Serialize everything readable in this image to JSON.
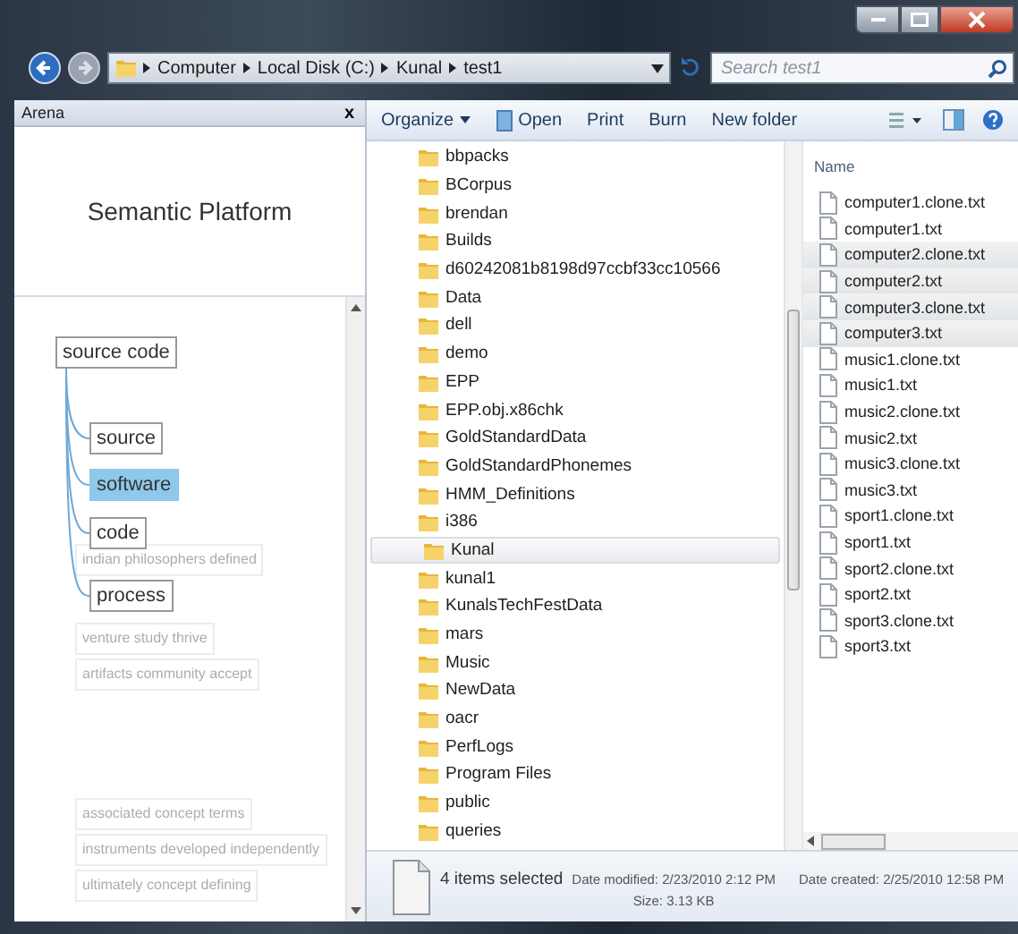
{
  "address_bar": {
    "crumbs": [
      "Computer",
      "Local Disk (C:)",
      "Kunal",
      "test1"
    ]
  },
  "search": {
    "placeholder": "Search test1"
  },
  "arena": {
    "title": "Arena",
    "close": "x",
    "heading": "Semantic Platform",
    "background_terms": [
      {
        "label": "indian philosophers defined"
      },
      {
        "label": "venture study thrive"
      },
      {
        "label": "artifacts community accept"
      },
      {
        "label": "associated concept terms"
      },
      {
        "label": "instruments developed independently"
      },
      {
        "label": "ultimately concept defining"
      }
    ],
    "nodes": [
      {
        "label": "source code",
        "selected": false
      },
      {
        "label": "source",
        "selected": false
      },
      {
        "label": "software",
        "selected": true
      },
      {
        "label": "code",
        "selected": false
      },
      {
        "label": "process",
        "selected": false
      }
    ]
  },
  "toolbar": {
    "items": [
      {
        "label": "Organize",
        "kind": "menu"
      },
      {
        "label": "Open",
        "kind": "icon"
      },
      {
        "label": "Print",
        "kind": "plain"
      },
      {
        "label": "Burn",
        "kind": "plain"
      },
      {
        "label": "New folder",
        "kind": "plain"
      }
    ]
  },
  "folders": [
    {
      "name": "bbpacks",
      "selected": false
    },
    {
      "name": "BCorpus",
      "selected": false
    },
    {
      "name": "brendan",
      "selected": false
    },
    {
      "name": "Builds",
      "selected": false
    },
    {
      "name": "d60242081b8198d97ccbf33cc10566",
      "selected": false
    },
    {
      "name": "Data",
      "selected": false
    },
    {
      "name": "dell",
      "selected": false
    },
    {
      "name": "demo",
      "selected": false
    },
    {
      "name": "EPP",
      "selected": false
    },
    {
      "name": "EPP.obj.x86chk",
      "selected": false
    },
    {
      "name": "GoldStandardData",
      "selected": false
    },
    {
      "name": "GoldStandardPhonemes",
      "selected": false
    },
    {
      "name": "HMM_Definitions",
      "selected": false
    },
    {
      "name": "i386",
      "selected": false
    },
    {
      "name": "Kunal",
      "selected": true
    },
    {
      "name": "kunal1",
      "selected": false
    },
    {
      "name": "KunalsTechFestData",
      "selected": false
    },
    {
      "name": "mars",
      "selected": false
    },
    {
      "name": "Music",
      "selected": false
    },
    {
      "name": "NewData",
      "selected": false
    },
    {
      "name": "oacr",
      "selected": false
    },
    {
      "name": "PerfLogs",
      "selected": false
    },
    {
      "name": "Program Files",
      "selected": false
    },
    {
      "name": "public",
      "selected": false
    },
    {
      "name": "queries",
      "selected": false
    }
  ],
  "files": {
    "column": "Name",
    "items": [
      {
        "name": "computer1.clone.txt",
        "selected": false
      },
      {
        "name": "computer1.txt",
        "selected": false
      },
      {
        "name": "computer2.clone.txt",
        "selected": true
      },
      {
        "name": "computer2.txt",
        "selected": true
      },
      {
        "name": "computer3.clone.txt",
        "selected": true
      },
      {
        "name": "computer3.txt",
        "selected": true
      },
      {
        "name": "music1.clone.txt",
        "selected": false
      },
      {
        "name": "music1.txt",
        "selected": false
      },
      {
        "name": "music2.clone.txt",
        "selected": false
      },
      {
        "name": "music2.txt",
        "selected": false
      },
      {
        "name": "music3.clone.txt",
        "selected": false
      },
      {
        "name": "music3.txt",
        "selected": false
      },
      {
        "name": "sport1.clone.txt",
        "selected": false
      },
      {
        "name": "sport1.txt",
        "selected": false
      },
      {
        "name": "sport2.clone.txt",
        "selected": false
      },
      {
        "name": "sport2.txt",
        "selected": false
      },
      {
        "name": "sport3.clone.txt",
        "selected": false
      },
      {
        "name": "sport3.txt",
        "selected": false
      }
    ]
  },
  "status": {
    "count": "4 items selected",
    "modified": "Date modified: 2/23/2010 2:12 PM",
    "size": "Size: 3.13 KB",
    "created": "Date created: 2/25/2010 12:58 PM"
  }
}
